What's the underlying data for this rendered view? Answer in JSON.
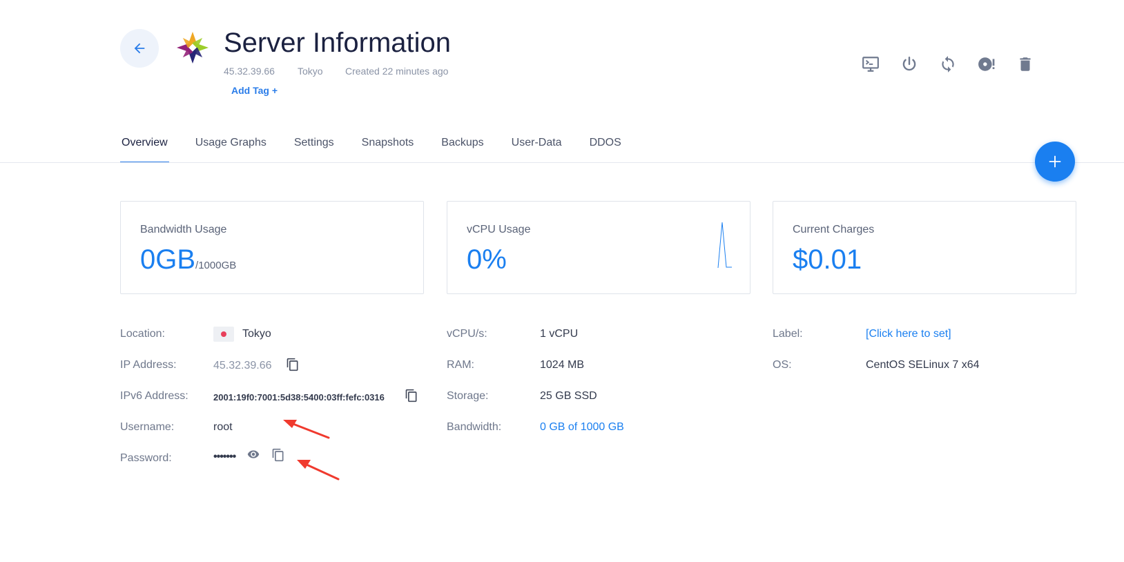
{
  "header": {
    "title": "Server Information",
    "ip": "45.32.39.66",
    "location": "Tokyo",
    "created": "Created 22 minutes ago",
    "add_tag": "Add Tag +"
  },
  "actions": [
    {
      "icon": "console-icon"
    },
    {
      "icon": "power-icon"
    },
    {
      "icon": "restart-icon"
    },
    {
      "icon": "reinstall-disc-icon"
    },
    {
      "icon": "trash-icon"
    }
  ],
  "tabs": [
    {
      "label": "Overview",
      "active": true
    },
    {
      "label": "Usage Graphs"
    },
    {
      "label": "Settings"
    },
    {
      "label": "Snapshots"
    },
    {
      "label": "Backups"
    },
    {
      "label": "User-Data"
    },
    {
      "label": "DDOS"
    }
  ],
  "cards": {
    "bandwidth": {
      "label": "Bandwidth Usage",
      "value": "0GB",
      "unit": "/1000GB"
    },
    "vcpu": {
      "label": "vCPU Usage",
      "value": "0%"
    },
    "charges": {
      "label": "Current Charges",
      "value": "$0.01"
    }
  },
  "details": {
    "location": {
      "label": "Location:",
      "value": "Tokyo"
    },
    "ip": {
      "label": "IP Address:",
      "value": "45.32.39.66"
    },
    "ipv6": {
      "label": "IPv6 Address:",
      "value": "2001:19f0:7001:5d38:5400:03ff:fefc:0316"
    },
    "username": {
      "label": "Username:",
      "value": "root"
    },
    "password": {
      "label": "Password:",
      "value": "•••••••"
    },
    "vcpus": {
      "label": "vCPU/s:",
      "value": "1 vCPU"
    },
    "ram": {
      "label": "RAM:",
      "value": "1024 MB"
    },
    "storage": {
      "label": "Storage:",
      "value": "25 GB SSD"
    },
    "bandwidth": {
      "label": "Bandwidth:",
      "value": "0 GB of 1000 GB"
    },
    "label": {
      "label": "Label:",
      "value": "[Click here to set]"
    },
    "os": {
      "label": "OS:",
      "value": "CentOS SELinux 7 x64"
    }
  },
  "colors": {
    "accent": "#1a7ff0",
    "annotation_arrow": "#f03a2e"
  }
}
